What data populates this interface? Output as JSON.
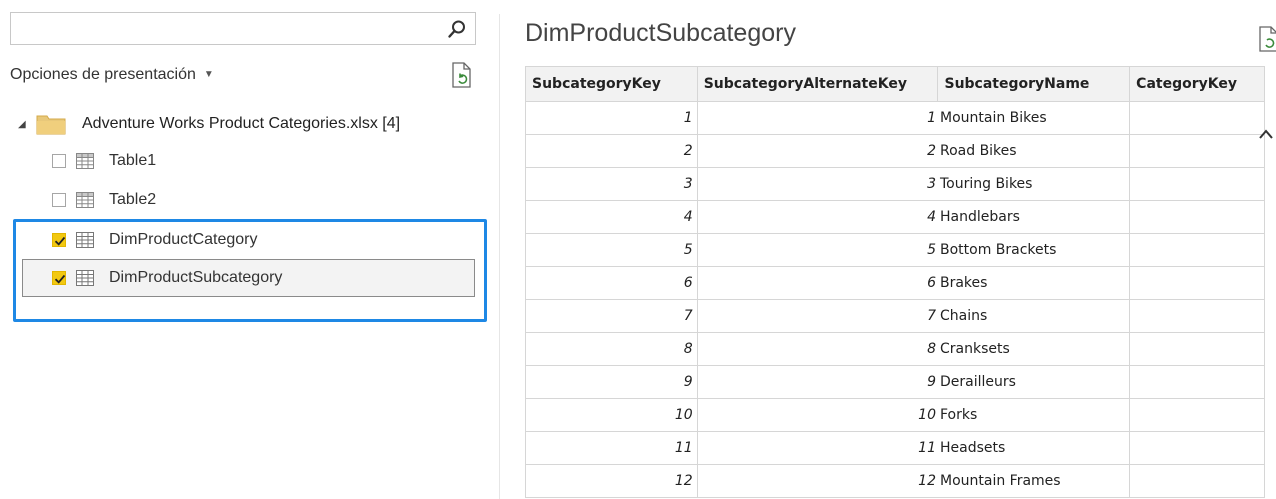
{
  "navigator": {
    "search": {
      "value": "",
      "placeholder": ""
    },
    "display_options_label": "Opciones de presentación",
    "root": {
      "label": "Adventure Works Product Categories.xlsx [4]",
      "expanded": true
    },
    "items": [
      {
        "label": "Table1",
        "checked": false
      },
      {
        "label": "Table2",
        "checked": false
      },
      {
        "label": "DimProductCategory",
        "checked": true
      },
      {
        "label": "DimProductSubcategory",
        "checked": true,
        "selected": true
      }
    ],
    "accent_color": "#1e88e5",
    "checkbox_color": "#f2c811"
  },
  "preview": {
    "title": "DimProductSubcategory",
    "columns": [
      "SubcategoryKey",
      "SubcategoryAlternateKey",
      "SubcategoryName",
      "CategoryKey"
    ],
    "rows": [
      [
        "1",
        "1",
        "Mountain Bikes",
        ""
      ],
      [
        "2",
        "2",
        "Road Bikes",
        ""
      ],
      [
        "3",
        "3",
        "Touring Bikes",
        ""
      ],
      [
        "4",
        "4",
        "Handlebars",
        ""
      ],
      [
        "5",
        "5",
        "Bottom Brackets",
        ""
      ],
      [
        "6",
        "6",
        "Brakes",
        ""
      ],
      [
        "7",
        "7",
        "Chains",
        ""
      ],
      [
        "8",
        "8",
        "Cranksets",
        ""
      ],
      [
        "9",
        "9",
        "Derailleurs",
        ""
      ],
      [
        "10",
        "10",
        "Forks",
        ""
      ],
      [
        "11",
        "11",
        "Headsets",
        ""
      ],
      [
        "12",
        "12",
        "Mountain Frames",
        ""
      ]
    ]
  }
}
